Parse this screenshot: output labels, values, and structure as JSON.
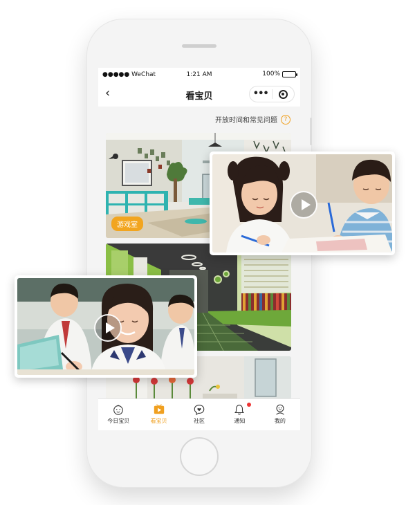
{
  "status_bar": {
    "carrier": "●●●●● WeChat",
    "time": "1:21 AM",
    "battery": "100%"
  },
  "nav": {
    "back_icon": "chevron-left-icon",
    "title": "看宝贝",
    "more_icon": "more-dots-icon",
    "close_icon": "close-target-icon"
  },
  "faq": {
    "label": "开放时间和常见问题",
    "icon_text": "?"
  },
  "cards": [
    {
      "label": "游戏室"
    },
    {
      "label": ""
    },
    {
      "label": ""
    }
  ],
  "tabs": [
    {
      "label": "今日宝贝",
      "icon": "baby-face-icon",
      "active": false
    },
    {
      "label": "看宝贝",
      "icon": "play-video-icon",
      "active": true
    },
    {
      "label": "社区",
      "icon": "chat-heart-icon",
      "active": false
    },
    {
      "label": "通知",
      "icon": "bell-icon",
      "active": false,
      "badge": true
    },
    {
      "label": "我的",
      "icon": "profile-icon",
      "active": false
    }
  ],
  "colors": {
    "accent": "#f0a020",
    "badge": "#e33333"
  }
}
